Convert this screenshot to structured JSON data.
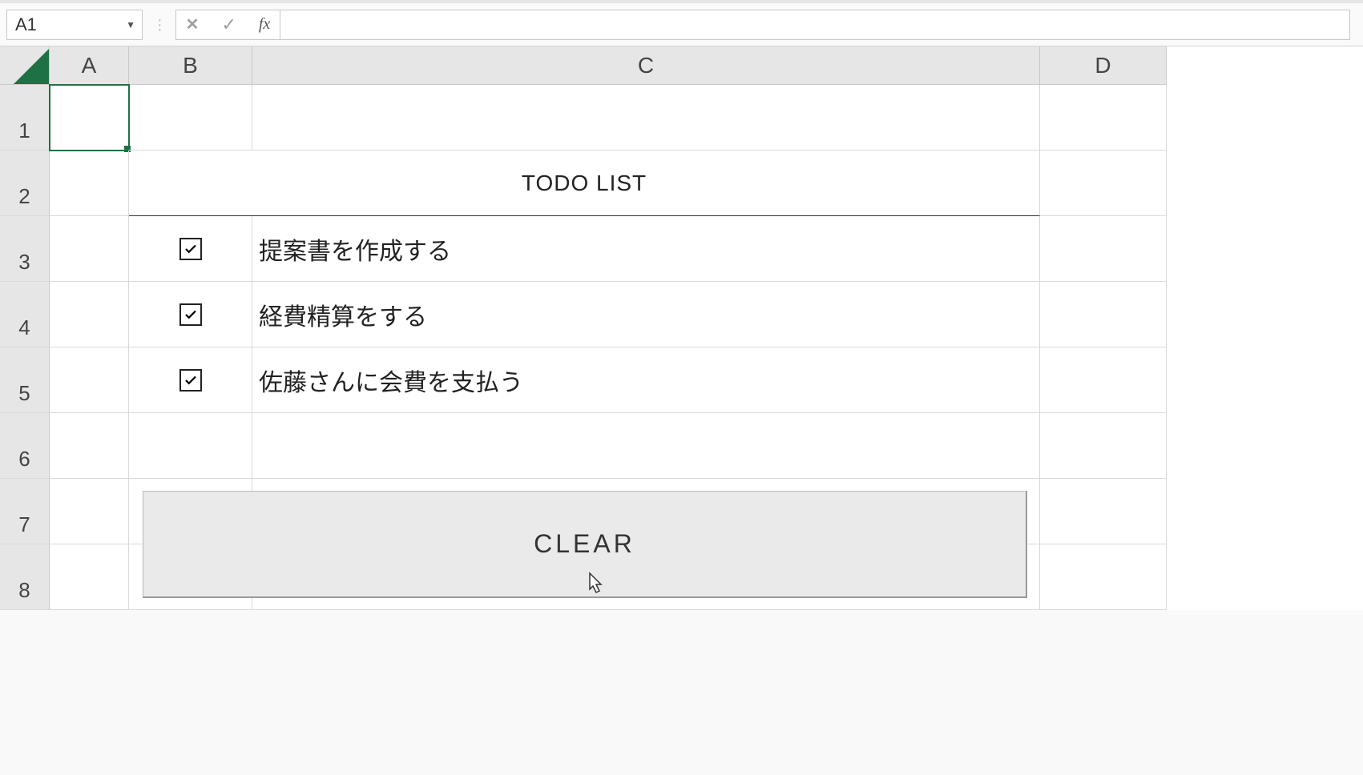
{
  "formula_bar": {
    "name_box": "A1",
    "formula_value": ""
  },
  "columns": [
    "A",
    "B",
    "C",
    "D"
  ],
  "rows": [
    "1",
    "2",
    "3",
    "4",
    "5",
    "6",
    "7",
    "8"
  ],
  "todo": {
    "title": "TODO LIST",
    "items": [
      {
        "checked": true,
        "text": "提案書を作成する"
      },
      {
        "checked": true,
        "text": "経費精算をする"
      },
      {
        "checked": true,
        "text": "佐藤さんに会費を支払う"
      }
    ],
    "clear_label": "CLEAR"
  }
}
